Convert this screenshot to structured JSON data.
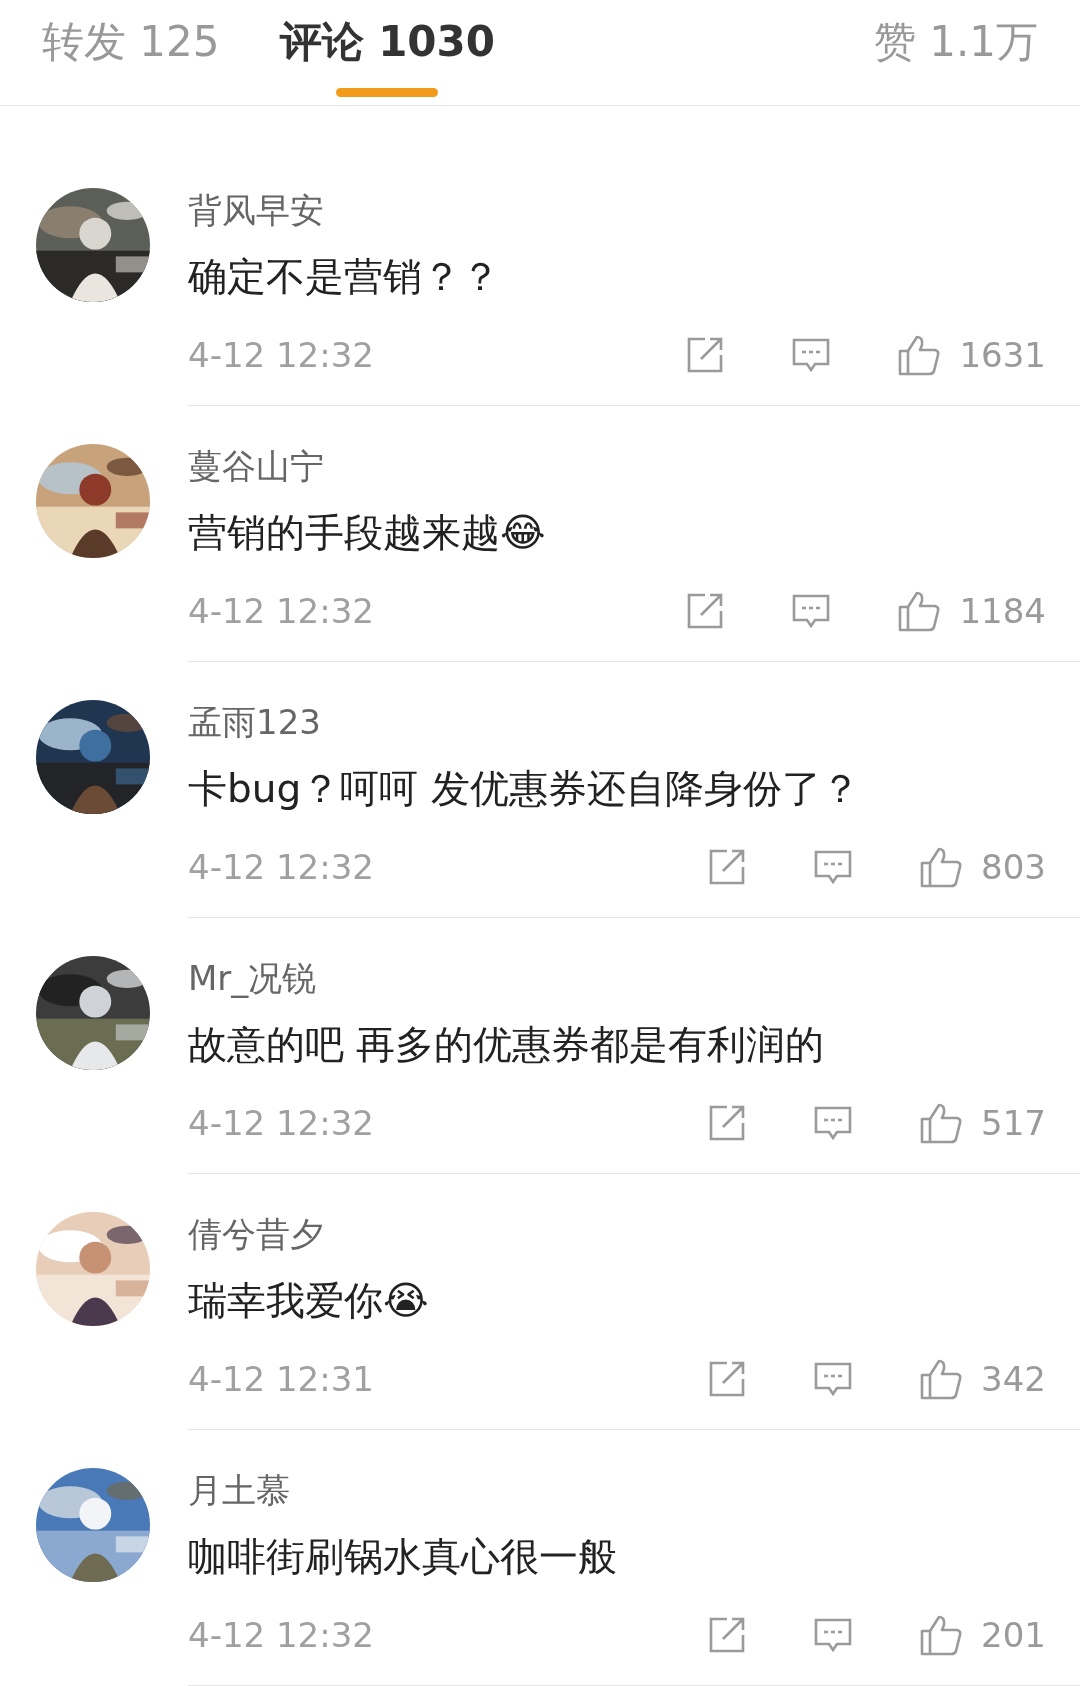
{
  "tabs": [
    {
      "label": "转发 125",
      "selected": false
    },
    {
      "label": "评论 1030",
      "selected": true
    },
    {
      "label": "赞 1.1万",
      "selected": false
    }
  ],
  "comments": [
    {
      "name": "背风早安",
      "text": "确定不是营销？？",
      "time": "4-12 12:32",
      "likes": "1631"
    },
    {
      "name": "蔓谷山宁",
      "text": "营销的手段越来越😂",
      "time": "4-12 12:32",
      "likes": "1184"
    },
    {
      "name": "孟雨123",
      "text": "卡bug？呵呵 发优惠券还自降身份了？",
      "time": "4-12 12:32",
      "likes": "803"
    },
    {
      "name": "Mr_况锐",
      "text": "故意的吧  再多的优惠券都是有利润的",
      "time": "4-12 12:32",
      "likes": "517"
    },
    {
      "name": "倩兮昔夕",
      "text": "瑞幸我爱你😭",
      "time": "4-12 12:31",
      "likes": "342"
    },
    {
      "name": "月土慕",
      "text": "咖啡街刷锅水真心很一般",
      "time": "4-12 12:32",
      "likes": "201"
    }
  ]
}
